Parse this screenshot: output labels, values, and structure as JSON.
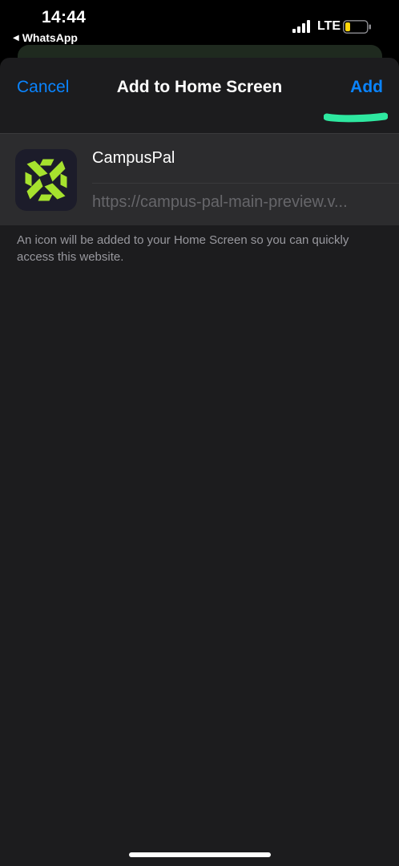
{
  "status_bar": {
    "time": "14:44",
    "back_app": "WhatsApp",
    "carrier": "LTE",
    "battery_color": "#ffd60a"
  },
  "nav": {
    "cancel_label": "Cancel",
    "title": "Add to Home Screen",
    "add_label": "Add",
    "accent_color": "#0a84ff",
    "highlight_color": "#2ee8a0"
  },
  "bookmark": {
    "name": "CampusPal",
    "url": "https://campus-pal-main-preview.v...",
    "icon": "campuspal-logo-icon",
    "icon_color": "#a6e22e"
  },
  "footer": {
    "note": "An icon will be added to your Home Screen so you can quickly access this website."
  }
}
